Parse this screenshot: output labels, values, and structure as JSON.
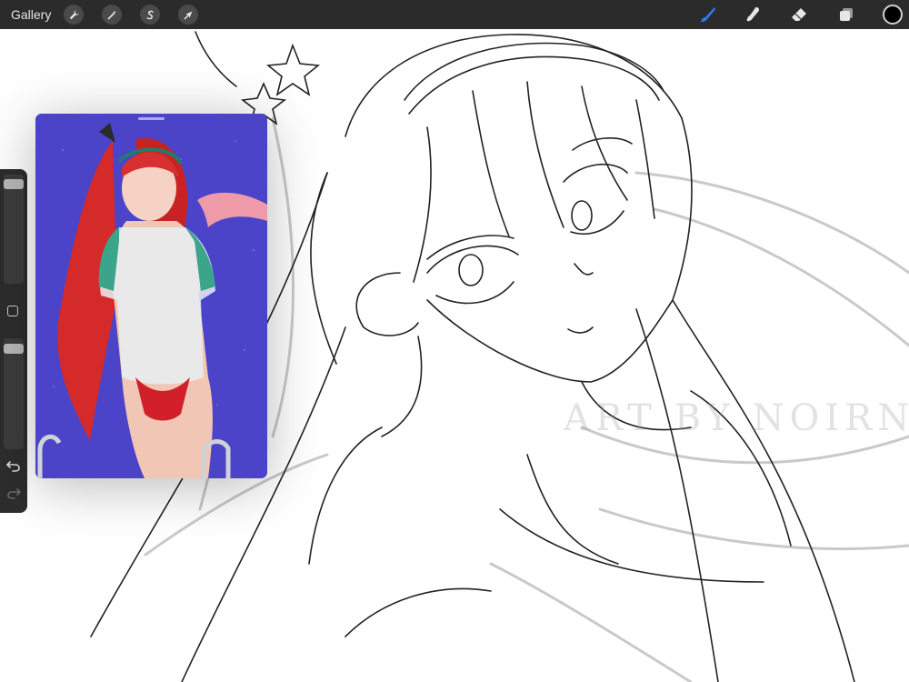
{
  "topbar": {
    "gallery_label": "Gallery",
    "left_tools": [
      {
        "name": "actions",
        "icon": "wrench-icon"
      },
      {
        "name": "adjustments",
        "icon": "magic-wand-icon"
      },
      {
        "name": "selection",
        "icon": "selection-s-icon"
      },
      {
        "name": "transform",
        "icon": "arrow-cursor-icon"
      }
    ],
    "right_tools": [
      {
        "name": "brush",
        "icon": "brush-icon",
        "active": true
      },
      {
        "name": "smudge",
        "icon": "smudge-finger-icon"
      },
      {
        "name": "eraser",
        "icon": "eraser-icon"
      },
      {
        "name": "layers",
        "icon": "layers-icon"
      }
    ],
    "active_tool_color": "#2f7df6",
    "current_color": "#000000"
  },
  "sidebar": {
    "brush_size_level": 0.05,
    "opacity_level": 0.05,
    "undo_icon": "undo-arrow-icon",
    "redo_icon": "redo-arrow-icon"
  },
  "canvas": {
    "watermark_text": "ART BY NOIRNIB"
  },
  "reference_window": {
    "background_color": "#4b44c9"
  }
}
